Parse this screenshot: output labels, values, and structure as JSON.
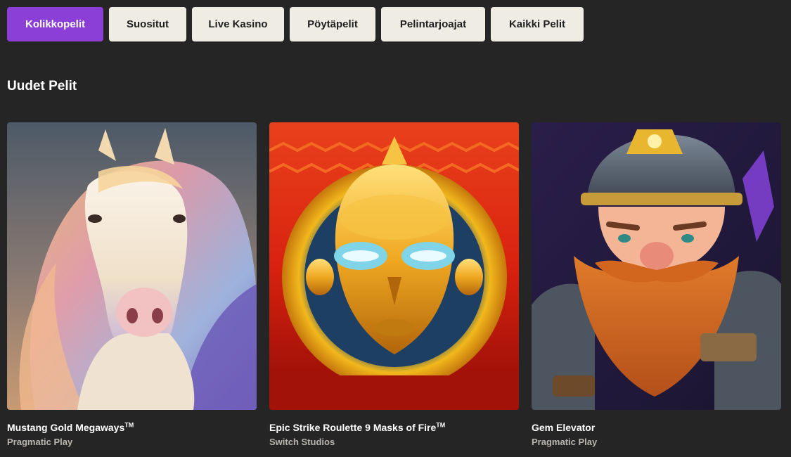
{
  "category_tabs": [
    {
      "label": "Kolikkopelit",
      "active": true
    },
    {
      "label": "Suositut",
      "active": false
    },
    {
      "label": "Live Kasino",
      "active": false
    },
    {
      "label": "Pöytäpelit",
      "active": false
    },
    {
      "label": "Pelintarjoajat",
      "active": false
    },
    {
      "label": "Kaikki Pelit",
      "active": false
    }
  ],
  "section": {
    "title": "Uudet Pelit"
  },
  "games": [
    {
      "name": "Mustang Gold Megaways",
      "trademark": "TM",
      "provider": "Pragmatic Play"
    },
    {
      "name": "Epic Strike Roulette 9 Masks of Fire",
      "trademark": "TM",
      "provider": "Switch Studios"
    },
    {
      "name": "Gem Elevator",
      "trademark": "",
      "provider": "Pragmatic Play"
    }
  ],
  "colors": {
    "page_background": "#252525",
    "active_tab": "#8b3fd6",
    "inactive_tab": "#efece4",
    "provider_text": "#b9b6ae"
  }
}
